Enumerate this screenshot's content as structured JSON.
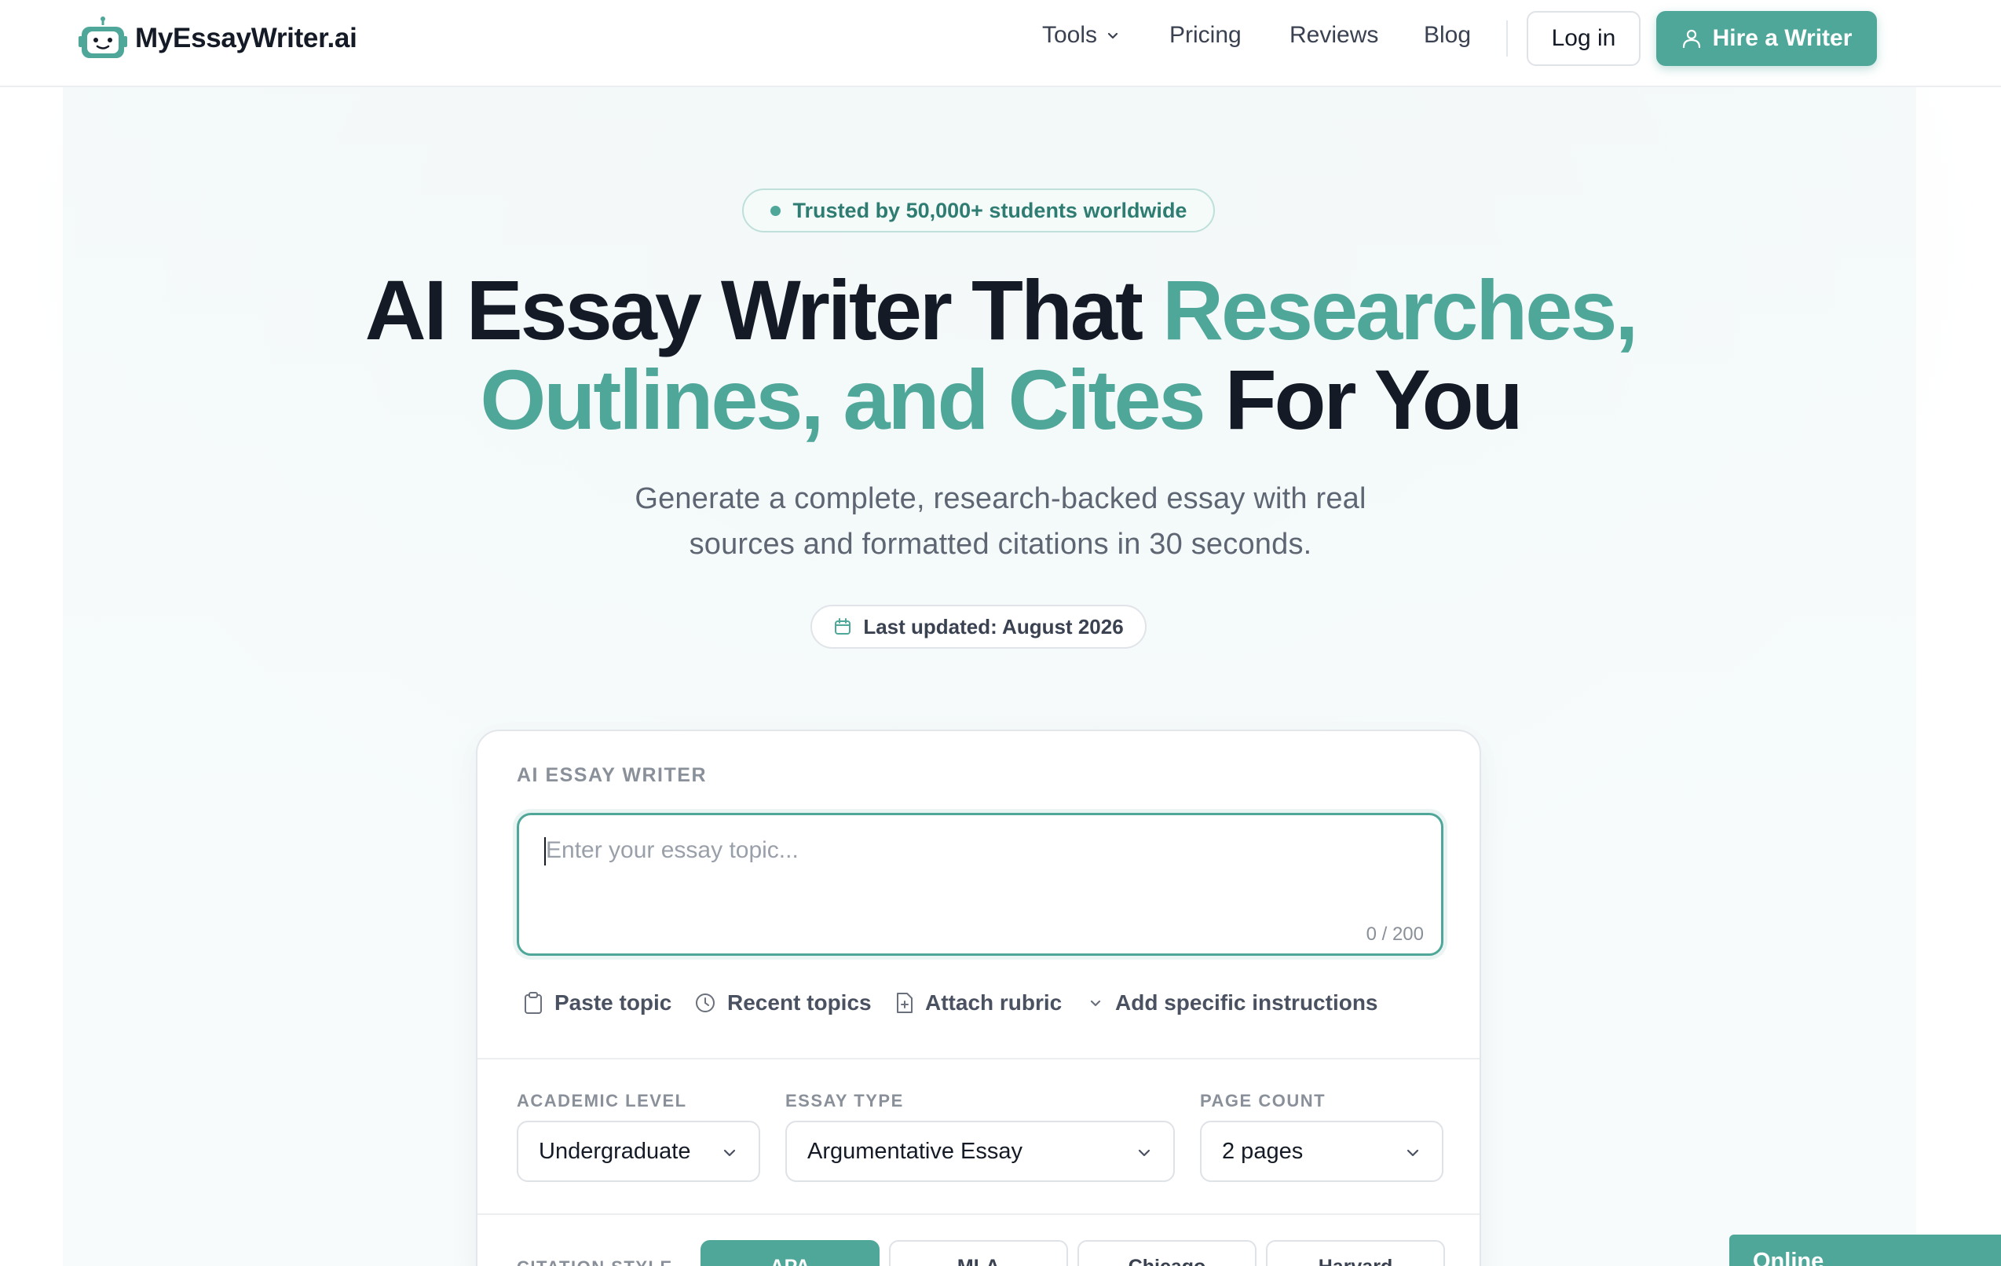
{
  "header": {
    "logo_text": "MyEssayWriter.ai",
    "nav": {
      "tools": "Tools",
      "pricing": "Pricing",
      "reviews": "Reviews",
      "blog": "Blog"
    },
    "login_label": "Log in",
    "hire_label": "Hire a Writer"
  },
  "hero": {
    "badge": "Trusted by 50,000+ students worldwide",
    "headline_part1": "AI Essay Writer That ",
    "headline_accent1": "Researches,",
    "headline_accent2": "Outlines, and Cites",
    "headline_part2": " For You",
    "subhead_line1": "Generate a complete, research-backed essay with real",
    "subhead_line2": "sources and formatted citations in 30 seconds.",
    "last_updated": "Last updated: August 2026"
  },
  "card": {
    "label": "AI ESSAY WRITER",
    "topic_placeholder": "Enter your essay topic...",
    "topic_counter": "0 / 200",
    "actions": {
      "paste": "Paste topic",
      "recent": "Recent topics",
      "attach": "Attach rubric",
      "add": "Add specific instructions"
    },
    "academic_level": {
      "label": "ACADEMIC LEVEL",
      "value": "Undergraduate"
    },
    "essay_type": {
      "label": "ESSAY TYPE",
      "value": "Argumentative Essay"
    },
    "page_count": {
      "label": "PAGE COUNT",
      "value": "2 pages"
    },
    "citation_style": {
      "label": "CITATION STYLE",
      "options": [
        "APA",
        "MLA",
        "Chicago",
        "Harvard"
      ],
      "selected": "APA"
    }
  },
  "chat_widget": {
    "status": "Online"
  },
  "colors": {
    "accent": "#4fa79a",
    "text_dark": "#141a26",
    "text_muted": "#5f6673"
  },
  "icons": {
    "logo": "robot-icon",
    "tools_caret": "chevron-down-icon",
    "hire": "user-icon",
    "updated": "calendar-icon",
    "paste": "clipboard-icon",
    "recent": "clock-icon",
    "attach": "file-plus-icon",
    "add": "chevron-down-icon"
  }
}
